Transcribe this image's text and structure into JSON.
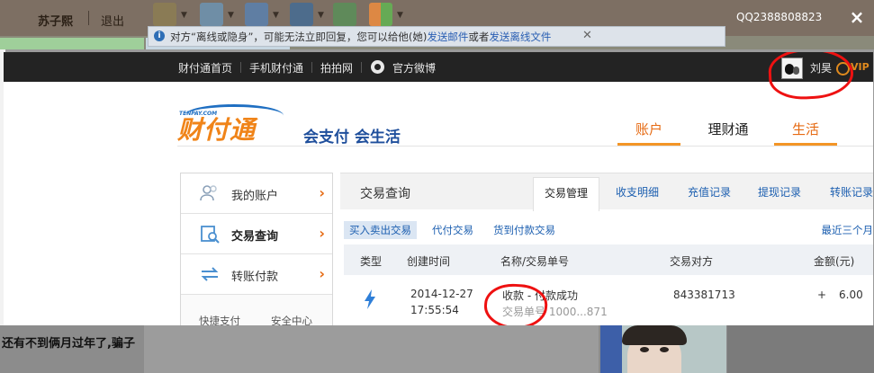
{
  "qq_window": {
    "username": "苏子熙",
    "exit_label": "退出",
    "qq_number": "QQ2388808823",
    "close_label": "×",
    "notice": {
      "text_prefix": "对方“离线或隐身”，可能无法立即回复，您可以给他(她)",
      "link_mail": "发送邮件",
      "text_or": "或者",
      "link_offline_file": "发送离线文件"
    },
    "chat_fragment": "还有不到俩月过年了,骗子"
  },
  "top_nav": {
    "items": [
      "财付通首页",
      "手机财付通",
      "拍拍网",
      "官方微博"
    ],
    "user_name": "刘昊",
    "vip_label": "VIP"
  },
  "header": {
    "logo_small": "TENPAY.COM",
    "brand": "财付通",
    "slogan": "会支付 会生活",
    "main_nav": [
      "账户",
      "理财通",
      "生活"
    ]
  },
  "sidebar": {
    "items": [
      {
        "label": "我的账户",
        "icon": "user-icon"
      },
      {
        "label": "交易查询",
        "icon": "search-doc-icon"
      },
      {
        "label": "转账付款",
        "icon": "transfer-icon"
      }
    ],
    "arrow": "›",
    "footer": [
      "快捷支付",
      "安全中心"
    ]
  },
  "content": {
    "title": "交易查询",
    "tabs": [
      "交易管理",
      "收支明细",
      "充值记录",
      "提现记录",
      "转账记录"
    ],
    "sub_tabs": [
      "买入卖出交易",
      "代付交易",
      "货到付款交易"
    ],
    "recent_filter": "最近三个月",
    "columns": [
      "类型",
      "创建时间",
      "名称/交易单号",
      "交易对方",
      "金额(元)"
    ],
    "rows": [
      {
        "type_icon": "lightning-icon",
        "date": "2014-12-27",
        "time": "17:55:54",
        "name": "收款 - 付款成功",
        "order_no": "交易单号 1000...871",
        "counterparty": "843381713",
        "sign": "+",
        "amount": "6.00"
      }
    ]
  },
  "colors": {
    "brand_orange": "#f08419",
    "link_blue": "#1c5fb0",
    "annotation_red": "#e11111"
  }
}
